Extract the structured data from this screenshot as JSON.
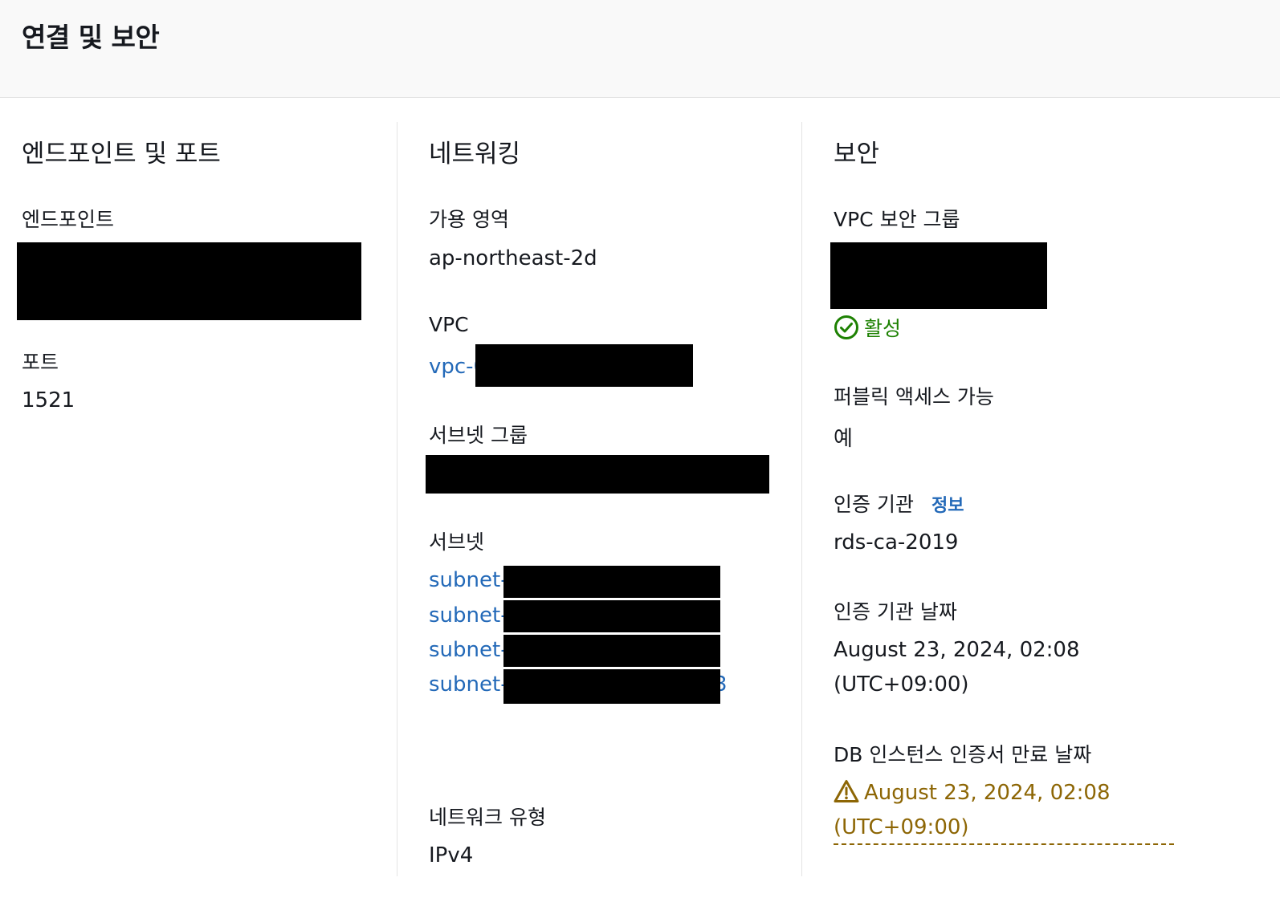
{
  "header": {
    "title": "연결 및 보안"
  },
  "endpoint_section": {
    "title": "엔드포인트 및 포트",
    "endpoint_label": "엔드포인트",
    "port_label": "포트",
    "port_value": "1521"
  },
  "networking_section": {
    "title": "네트워킹",
    "az_label": "가용 영역",
    "az_value": "ap-northeast-2d",
    "vpc_label": "VPC",
    "vpc_link_prefix": "vpc-0",
    "subnet_group_label": "서브넷 그룹",
    "subnets_label": "서브넷",
    "subnets": [
      {
        "prefix": "subnet-"
      },
      {
        "prefix": "subnet-"
      },
      {
        "prefix": "subnet-"
      },
      {
        "prefix": "subnet-",
        "suffix": "3"
      }
    ],
    "network_type_label": "네트워크 유형",
    "network_type_value": "IPv4"
  },
  "security_section": {
    "title": "보안",
    "sg_label": "VPC 보안 그룹",
    "sg_status": "활성",
    "sg_status_color": "#1d8102",
    "public_access_label": "퍼블릭 액세스 가능",
    "public_access_value": "예",
    "ca_label": "인증 기관",
    "ca_info_link": "정보",
    "ca_value": "rds-ca-2019",
    "ca_date_label": "인증 기관 날짜",
    "ca_date_line1": "August 23, 2024, 02:08",
    "ca_date_line2": "(UTC+09:00)",
    "cert_expiry_label": "DB 인스턴스 인증서 만료 날짜",
    "cert_expiry_value": "August 23, 2024, 02:08 (UTC+09:00)",
    "warning_color": "#8d6605",
    "icons": {
      "status": "check-circle-icon",
      "warning": "warning-triangle-icon"
    }
  }
}
